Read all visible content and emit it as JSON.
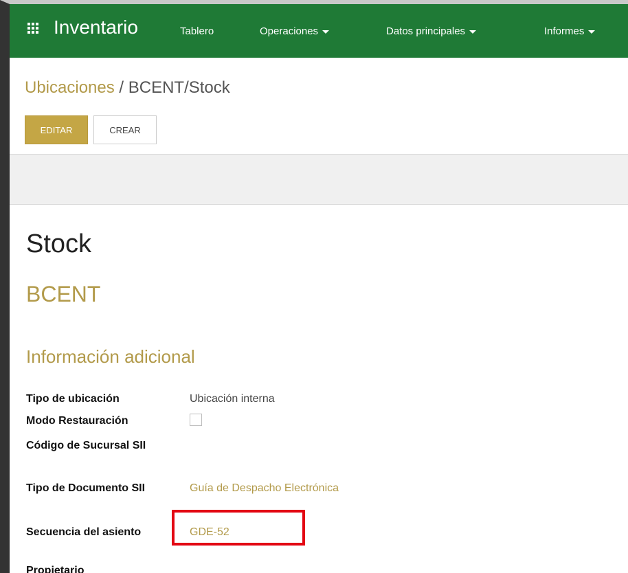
{
  "navbar": {
    "app_title": "Inventario",
    "items": [
      {
        "label": "Tablero",
        "has_caret": false
      },
      {
        "label": "Operaciones",
        "has_caret": true
      },
      {
        "label": "Datos principales",
        "has_caret": true
      },
      {
        "label": "Informes",
        "has_caret": true
      }
    ]
  },
  "breadcrumb": {
    "parent": "Ubicaciones",
    "separator": "/",
    "current": "BCENT/Stock"
  },
  "buttons": {
    "edit": "EDITAR",
    "create": "CREAR"
  },
  "record": {
    "name": "Stock",
    "parent_location": "BCENT"
  },
  "section": {
    "title": "Información adicional",
    "fields": [
      {
        "label": "Tipo de ubicación",
        "value": "Ubicación interna"
      },
      {
        "label": "Modo Restauración",
        "value": ""
      },
      {
        "label": "Código de Sucursal SII",
        "value": ""
      },
      {
        "label": "Tipo de Documento SII",
        "value": "Guía de Despacho Electrónica"
      },
      {
        "label": "Secuencia del asiento",
        "value": "GDE-52"
      },
      {
        "label": "Propietario",
        "value": ""
      }
    ]
  },
  "colors": {
    "navbar": "#1f7a36",
    "accent": "#b29a4a",
    "highlight": "#e30613"
  },
  "icons": {
    "apps": "apps-grid-icon",
    "dropdown": "caret-down-icon"
  }
}
